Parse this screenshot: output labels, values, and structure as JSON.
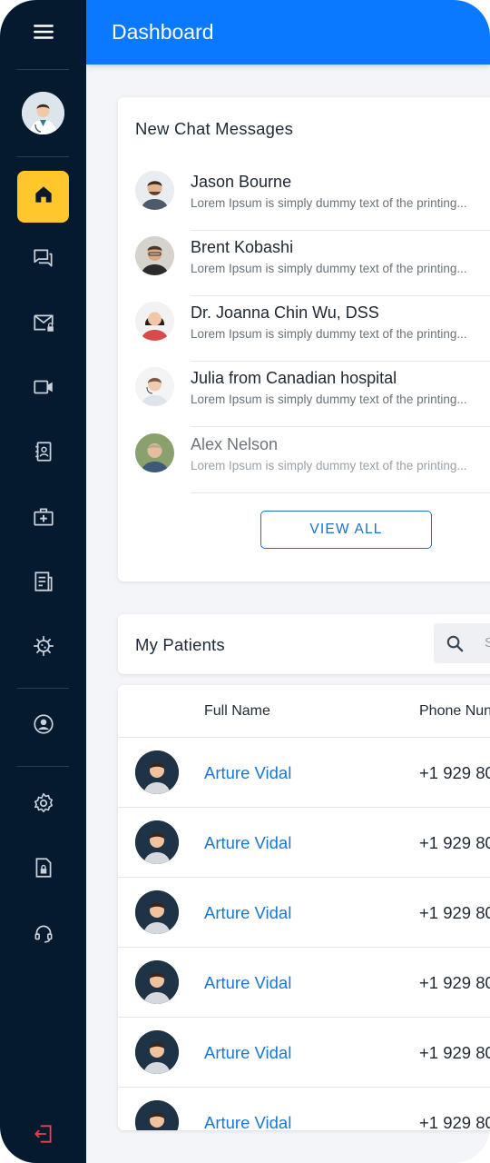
{
  "header": {
    "title": "Dashboard"
  },
  "sidebar": {
    "items": [
      {
        "icon": "menu-icon"
      },
      {
        "icon": "doctor-avatar"
      },
      {
        "icon": "home-icon",
        "active": true
      },
      {
        "icon": "chat-icon"
      },
      {
        "icon": "mail-lock-icon"
      },
      {
        "icon": "video-icon"
      },
      {
        "icon": "contacts-icon"
      },
      {
        "icon": "medical-kit-icon"
      },
      {
        "icon": "report-icon"
      },
      {
        "icon": "virus-icon"
      },
      {
        "icon": "account-icon"
      },
      {
        "icon": "settings-icon"
      },
      {
        "icon": "lock-file-icon"
      },
      {
        "icon": "headset-icon"
      },
      {
        "icon": "logout-icon"
      }
    ],
    "accent": "#ffc72c",
    "background": "#061a2f"
  },
  "chat": {
    "title": "New Chat Messages",
    "messages": [
      {
        "name": "Jason Bourne",
        "preview": "Lorem Ipsum is simply dummy text of the printing..."
      },
      {
        "name": "Brent Kobashi",
        "preview": "Lorem Ipsum is simply dummy text of the printing..."
      },
      {
        "name": "Dr. Joanna Chin Wu, DSS",
        "preview": "Lorem Ipsum is simply dummy text of the printing..."
      },
      {
        "name": "Julia from Canadian hospital",
        "preview": "Lorem Ipsum is simply dummy text of the printing..."
      },
      {
        "name": "Alex Nelson",
        "preview": "Lorem Ipsum is simply dummy text of the printing..."
      }
    ],
    "view_all_label": "VIEW ALL"
  },
  "patients": {
    "title": "My Patients",
    "search_placeholder": "S",
    "columns": [
      "Full Name",
      "Phone Nun"
    ],
    "rows": [
      {
        "name": "Arture Vidal",
        "phone": "+1 929 80"
      },
      {
        "name": "Arture Vidal",
        "phone": "+1 929 80"
      },
      {
        "name": "Arture Vidal",
        "phone": "+1 929 80"
      },
      {
        "name": "Arture Vidal",
        "phone": "+1 929 80"
      },
      {
        "name": "Arture Vidal",
        "phone": "+1 929 80"
      },
      {
        "name": "Arture Vidal",
        "phone": "+1 929 80"
      }
    ]
  },
  "colors": {
    "primary": "#0a79ff",
    "link": "#1a78d2"
  }
}
